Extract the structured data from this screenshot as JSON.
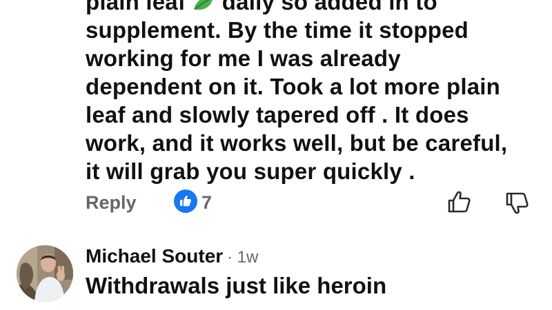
{
  "previous_comment": {
    "lines": [
      "plain leaf",
      "daily so added in to",
      "supplement.  By the time it stopped",
      "working for me I was already",
      "dependent on it. Took a lot more plain",
      "leaf and slowly tapered off .  It does",
      "work, and it works well,  but be careful,",
      "it will grab you super quickly ."
    ],
    "leaf_icon": "leaf-icon",
    "reply_label": "Reply",
    "like_icon": "thumbs-up-icon",
    "like_count": "7",
    "reaction_like_icon": "thumbs-up-outline-icon",
    "reaction_dislike_icon": "thumbs-down-outline-icon",
    "like_color": "#1877f2"
  },
  "reply_comment": {
    "author": "Michael Souter",
    "separator": "·",
    "time": "1w",
    "text": "Withdrawals just like heroin",
    "avatar_icon": "avatar"
  }
}
